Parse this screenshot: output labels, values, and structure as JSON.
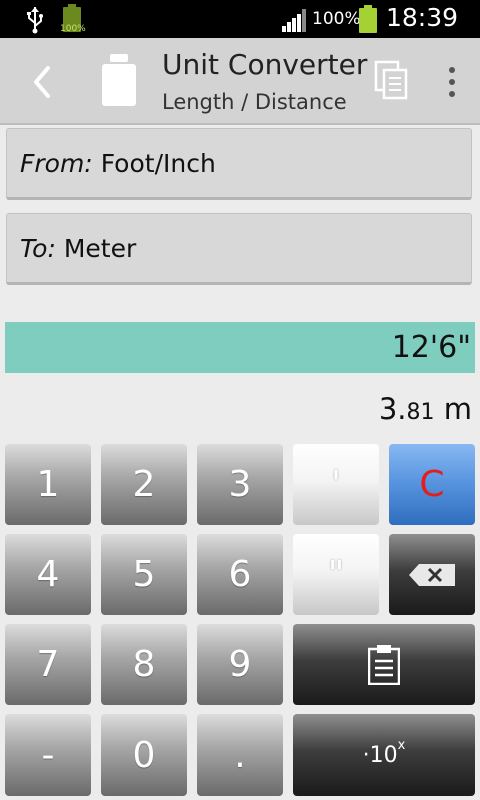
{
  "status_bar": {
    "small_battery_text": "100%",
    "battery_percent": "100%",
    "time": "18:39"
  },
  "action_bar": {
    "title": "Unit Converter",
    "subtitle": "Length / Distance",
    "icons": [
      "back-icon",
      "weight-icon",
      "copy-icon",
      "overflow-menu-icon"
    ]
  },
  "converter": {
    "from_label": "From:",
    "from_unit": "Foot/Inch",
    "to_label": "To:",
    "to_unit": "Meter",
    "input_value": "12'6\"",
    "result_int": "3.",
    "result_dec": "81",
    "result_unit": "m"
  },
  "keypad": {
    "k1": "1",
    "k2": "2",
    "k3": "3",
    "k4": "4",
    "k5": "5",
    "k6": "6",
    "k7": "7",
    "k8": "8",
    "k9": "9",
    "minus": "-",
    "k0": "0",
    "dot": ".",
    "foot": "'",
    "inch": "\"",
    "clear": "C",
    "exp_base": "·10",
    "exp_sup": "x"
  },
  "colors": {
    "input_bar": "#7ecdbf",
    "clear_key": "#5a96e0",
    "clear_text": "#e51d1d",
    "battery": "#a4d233"
  }
}
